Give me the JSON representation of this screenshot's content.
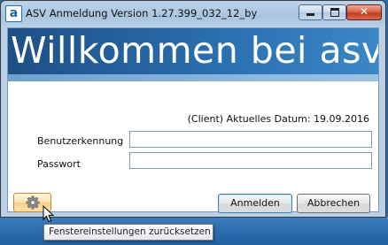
{
  "window": {
    "icon_letter": "a",
    "title": "ASV Anmeldung Version 1.27.399_032_12_by",
    "minimize_icon": "minimize-icon",
    "maximize_icon": "maximize-icon",
    "close_icon": "close-icon",
    "close_glyph": "✕"
  },
  "banner": {
    "title": "Willkommen bei asv"
  },
  "status": {
    "date_line": "(Client) Aktuelles Datum: 19.09.2016"
  },
  "form": {
    "username_label": "Benutzerkennung",
    "username_value": "",
    "password_label": "Passwort",
    "password_value": ""
  },
  "buttons": {
    "settings_icon": "gear-icon",
    "login_label": "Anmelden",
    "cancel_label": "Abbrechen"
  },
  "tooltip": {
    "text": "Fenstereinstellungen zurücksetzen"
  },
  "colors": {
    "banner_dark": "#1e4f86",
    "banner_light": "#3b86c6",
    "close_red": "#c23c1e",
    "gear_highlight": "#f8cf85"
  }
}
